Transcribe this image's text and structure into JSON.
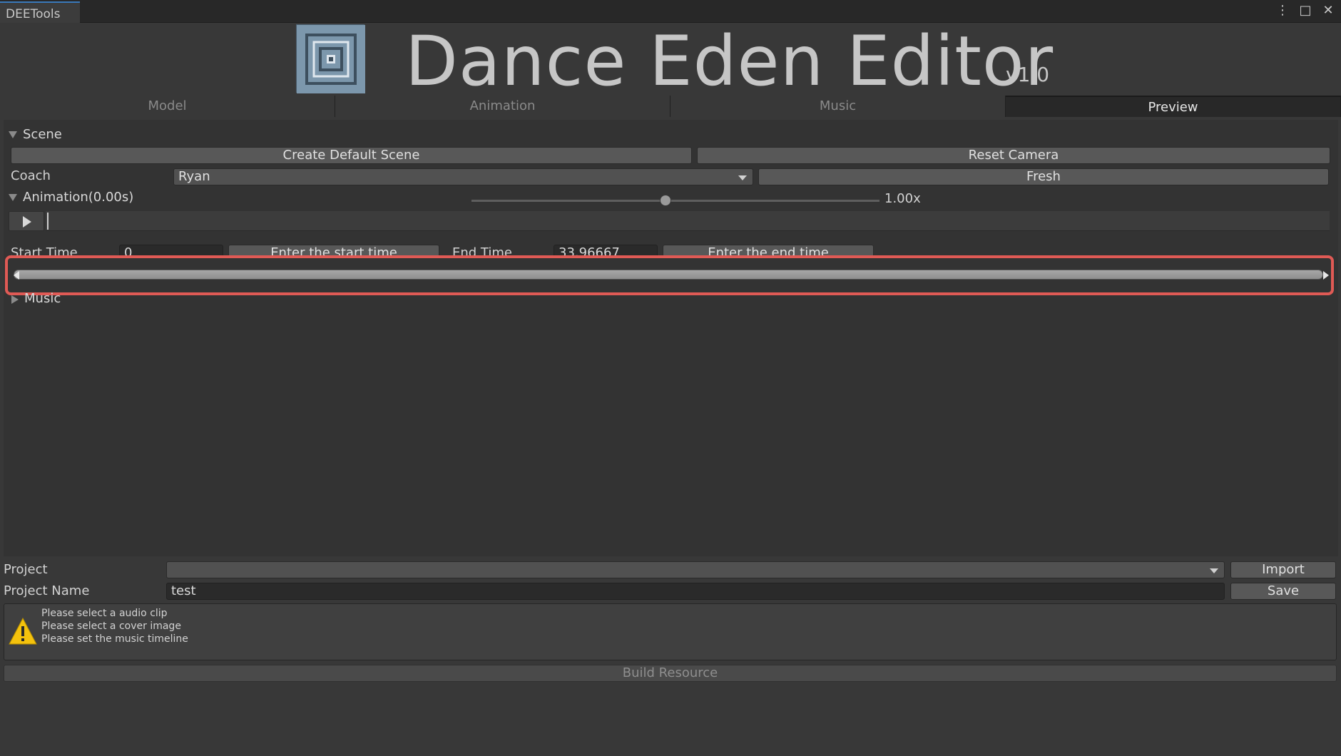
{
  "window": {
    "tab_title": "DEETools"
  },
  "header": {
    "title": "Dance Eden Editor",
    "version": "v1.0",
    "logo_icon": "maze-logo-icon"
  },
  "tabs": [
    {
      "label": "Model",
      "active": false
    },
    {
      "label": "Animation",
      "active": false
    },
    {
      "label": "Music",
      "active": false
    },
    {
      "label": "Preview",
      "active": true
    }
  ],
  "scene": {
    "header": "Scene",
    "create_default_scene": "Create Default Scene",
    "reset_camera": "Reset Camera",
    "coach_label": "Coach",
    "coach_value": "Ryan",
    "fresh": "Fresh"
  },
  "animation": {
    "header": "Animation(0.00s)",
    "speed": "1.00x",
    "speed_value": 1.0,
    "start_time_label": "Start Time",
    "start_time_value": "0",
    "enter_start_time": "Enter the start time",
    "end_time_label": "End Time",
    "end_time_value": "33.96667",
    "enter_end_time": "Enter the end time"
  },
  "music": {
    "header": "Music"
  },
  "project": {
    "label": "Project",
    "value": "",
    "import": "Import",
    "name_label": "Project Name",
    "name_value": "test",
    "save": "Save"
  },
  "help": {
    "lines": [
      "Please select a audio clip",
      "Please select a cover image",
      "Please set the music timeline"
    ]
  },
  "build": {
    "label": "Build Resource"
  },
  "colors": {
    "highlight": "#e05a55",
    "tab_accent": "#3a79bb",
    "warning": "#f4c20d"
  }
}
